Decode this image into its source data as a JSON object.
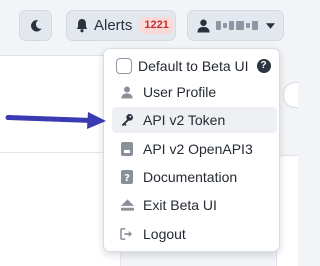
{
  "header": {
    "theme_icon": "moon-icon",
    "alerts": {
      "icon": "bell-icon",
      "label": "Alerts",
      "count": "1221"
    },
    "user": {
      "icon": "user-icon",
      "caret_icon": "caret-down-icon"
    }
  },
  "menu": {
    "items": [
      {
        "label": "Default to Beta UI",
        "icon": "checkbox",
        "help_icon": "question-circle-icon"
      },
      {
        "label": "User Profile",
        "icon": "user-icon"
      },
      {
        "label": "API v2 Token",
        "icon": "key-icon",
        "highlighted": true
      },
      {
        "label": "API v2 OpenAPI3",
        "icon": "document-icon"
      },
      {
        "label": "Documentation",
        "icon": "help-book-icon"
      },
      {
        "label": "Exit Beta UI",
        "icon": "eject-icon"
      },
      {
        "label": "Logout",
        "icon": "sign-out-icon"
      }
    ]
  },
  "colors": {
    "arrow": "#3a3bb0",
    "badge_bg": "#fbd9d9",
    "badge_text": "#c43232",
    "highlight": "#eef0f4"
  }
}
